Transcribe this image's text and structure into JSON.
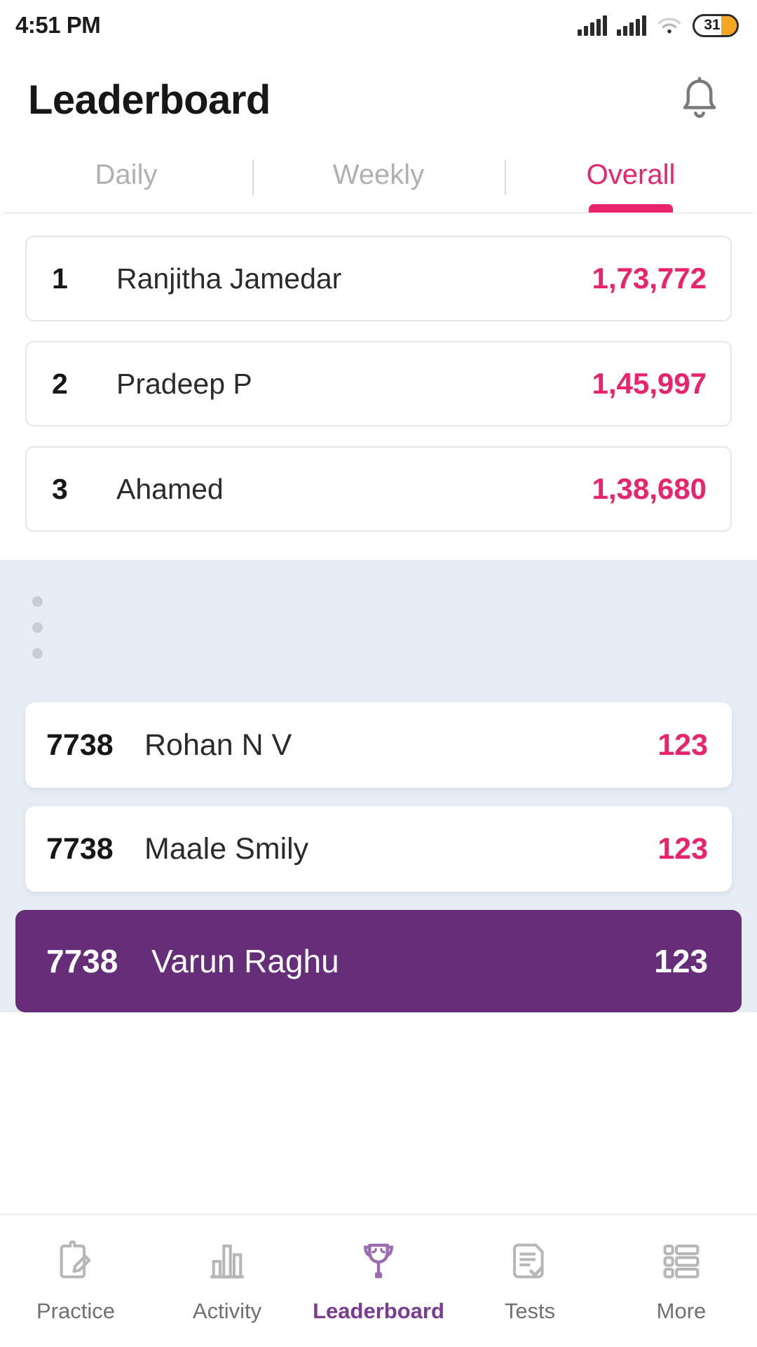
{
  "status_bar": {
    "time": "4:51 PM",
    "battery_level": "31",
    "icons": [
      "signal-icon",
      "signal-icon",
      "wifi-icon",
      "battery-icon"
    ]
  },
  "header": {
    "title": "Leaderboard",
    "notification_icon": "bell-icon"
  },
  "tabs": [
    {
      "label": "Daily",
      "active": false
    },
    {
      "label": "Weekly",
      "active": false
    },
    {
      "label": "Overall",
      "active": true
    }
  ],
  "top_ranks": [
    {
      "rank": "1",
      "name": "Ranjitha Jamedar",
      "score": "1,73,772"
    },
    {
      "rank": "2",
      "name": "Pradeep P",
      "score": "1,45,997"
    },
    {
      "rank": "3",
      "name": "Ahamed",
      "score": "1,38,680"
    }
  ],
  "nearby_ranks": [
    {
      "rank": "7738",
      "name": "Rohan N V",
      "score": "123",
      "is_current_user": false
    },
    {
      "rank": "7738",
      "name": "Maale Smily",
      "score": "123",
      "is_current_user": false
    },
    {
      "rank": "7738",
      "name": "Varun Raghu",
      "score": "123",
      "is_current_user": true
    }
  ],
  "bottom_nav": [
    {
      "label": "Practice",
      "icon": "clipboard-pencil-icon",
      "active": false
    },
    {
      "label": "Activity",
      "icon": "bar-chart-icon",
      "active": false
    },
    {
      "label": "Leaderboard",
      "icon": "trophy-icon",
      "active": true
    },
    {
      "label": "Tests",
      "icon": "document-check-icon",
      "active": false
    },
    {
      "label": "More",
      "icon": "list-grid-icon",
      "active": false
    }
  ],
  "colors": {
    "accent_pink": "#E8246D",
    "accent_purple": "#662D79",
    "nav_active": "#7A3C92",
    "panel_bg": "#E7EDF5",
    "battery_fill": "#F5A623"
  }
}
